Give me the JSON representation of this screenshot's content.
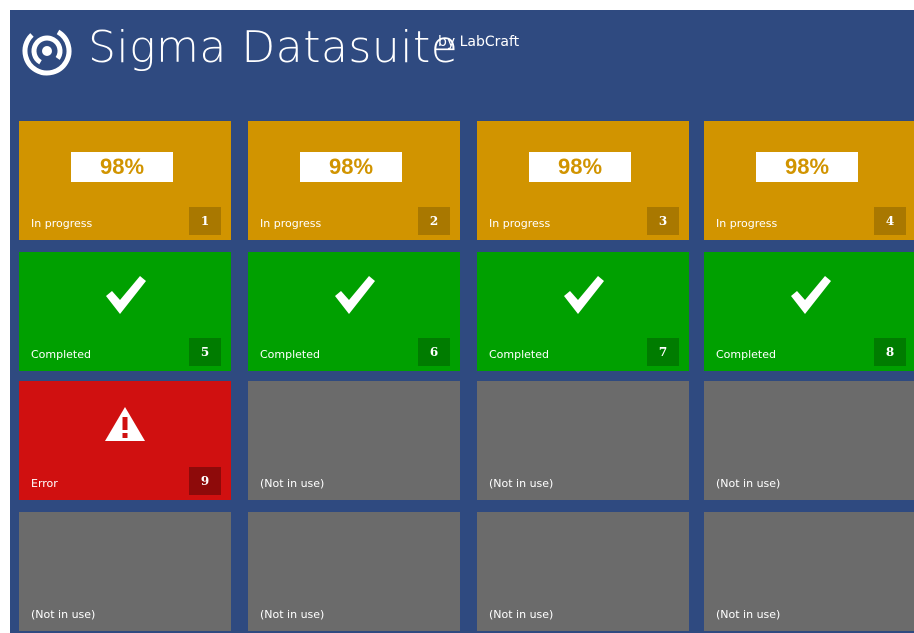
{
  "header": {
    "title": "Sigma Datasuite",
    "byline": "by LabCraft",
    "logo_icon": "swirl-logo-icon"
  },
  "colors": {
    "background": "#2f4a80",
    "in_progress": "#d19400",
    "in_progress_badge": "#a97800",
    "completed": "#00a000",
    "completed_badge": "#007c00",
    "error": "#d01010",
    "error_badge": "#8e0a0a",
    "idle": "#6b6b6b"
  },
  "tiles": [
    {
      "status": "in_progress",
      "label": "In progress",
      "percent": "98%",
      "number": "1"
    },
    {
      "status": "in_progress",
      "label": "In progress",
      "percent": "98%",
      "number": "2"
    },
    {
      "status": "in_progress",
      "label": "In progress",
      "percent": "98%",
      "number": "3"
    },
    {
      "status": "in_progress",
      "label": "In progress",
      "percent": "98%",
      "number": "4"
    },
    {
      "status": "completed",
      "label": "Completed",
      "icon": "checkmark-icon",
      "number": "5"
    },
    {
      "status": "completed",
      "label": "Completed",
      "icon": "checkmark-icon",
      "number": "6"
    },
    {
      "status": "completed",
      "label": "Completed",
      "icon": "checkmark-icon",
      "number": "7"
    },
    {
      "status": "completed",
      "label": "Completed",
      "icon": "checkmark-icon",
      "number": "8"
    },
    {
      "status": "error",
      "label": "Error",
      "icon": "warning-icon",
      "number": "9"
    },
    {
      "status": "idle",
      "label": "(Not in use)"
    },
    {
      "status": "idle",
      "label": "(Not in use)"
    },
    {
      "status": "idle",
      "label": "(Not in use)"
    },
    {
      "status": "idle",
      "label": "(Not in use)"
    },
    {
      "status": "idle",
      "label": "(Not in use)"
    },
    {
      "status": "idle",
      "label": "(Not in use)"
    },
    {
      "status": "idle",
      "label": "(Not in use)"
    }
  ]
}
